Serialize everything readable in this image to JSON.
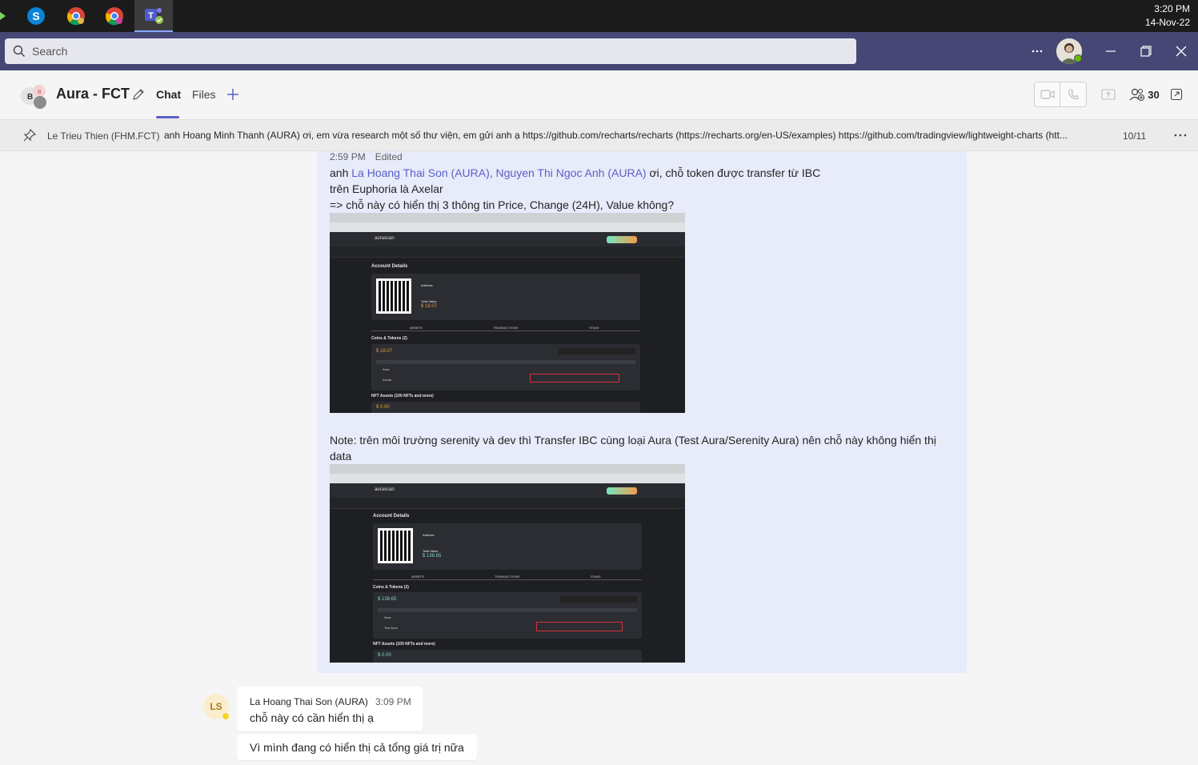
{
  "taskbar": {
    "apps": [
      {
        "name": "skype",
        "icon": "skype-icon"
      },
      {
        "name": "chrome",
        "icon": "chrome-icon"
      },
      {
        "name": "chrome-2",
        "icon": "chrome-icon"
      },
      {
        "name": "teams",
        "icon": "teams-icon"
      }
    ],
    "time": "3:20 PM",
    "date": "14-Nov-22"
  },
  "titlebar": {
    "search_placeholder": "Search",
    "more_label": "···"
  },
  "chat": {
    "title": "Aura - FCT",
    "avatar_initial": "B",
    "tabs": [
      {
        "label": "Chat"
      },
      {
        "label": "Files"
      }
    ],
    "participants_count": "30"
  },
  "pinned": {
    "author": "Le Trieu Thien (FHM.FCT)",
    "text": "anh Hoang Minh Thanh (AURA) ơi, em vừa research một số thư viện, em gửi anh ạ https://github.com/recharts/recharts (https://recharts.org/en-US/examples) https://github.com/tradingview/lightweight-charts (htt...",
    "counter": "10/11"
  },
  "my_message": {
    "time": "2:59 PM",
    "edited": "Edited",
    "line1_prefix": "anh ",
    "mention1": "La Hoang Thai Son (AURA)",
    "separator": ", ",
    "mention2": "Nguyen Thi Ngoc Anh (AURA)",
    "line1_suffix": " ơi, chỗ token được transfer từ IBC",
    "line2": "trên Euphoria là Axelar",
    "line3": "=> chỗ này có hiển thị 3 thông tin Price, Change (24H), Value không?",
    "note_line1": "Note: trên môi trường serenity và dev thì Transfer IBC cùng loại Aura (Test Aura/Serenity Aura) nên chỗ này không hiển thị",
    "note_line2": "data"
  },
  "screenshot1": {
    "app": "aurascan",
    "section": "Account Details",
    "address_label": "Address",
    "total_label": "Total Value",
    "total_value": "$ 18.07",
    "tabs": [
      "ASSETS",
      "TRANSACTIONS",
      "STAKE"
    ],
    "coins_title": "Coins & Tokens (2)",
    "coins_value": "$ 18.07",
    "rows": [
      "Aura",
      "Axelar"
    ],
    "nft_title": "NFT Assets (100 NFTs and more)",
    "nft_value": "$ 0.00"
  },
  "screenshot2": {
    "app": "aurascan",
    "section": "Account Details",
    "address_label": "Address",
    "total_label": "Total Value",
    "total_value": "$ 138.65",
    "tabs": [
      "ASSETS",
      "TRANSACTIONS",
      "STAKE"
    ],
    "coins_title": "Coins & Tokens (2)",
    "coins_value": "$ 138.65",
    "rows": [
      "Aura",
      "Test Aura"
    ],
    "nft_title": "NFT Assets (100 NFTs and more)",
    "nft_value": "$ 0.00"
  },
  "reply": {
    "avatar": "LS",
    "author": "La Hoang Thai Son (AURA)",
    "time": "3:09 PM",
    "text1": "chỗ này có cần hiển thị ạ",
    "text2": "Vì mình đang có hiển thị cả tổng giá trị nữa"
  },
  "colors": {
    "titlebar": "#464775",
    "accent": "#5b5fc7",
    "my_message_bg": "#e8ebfa"
  }
}
